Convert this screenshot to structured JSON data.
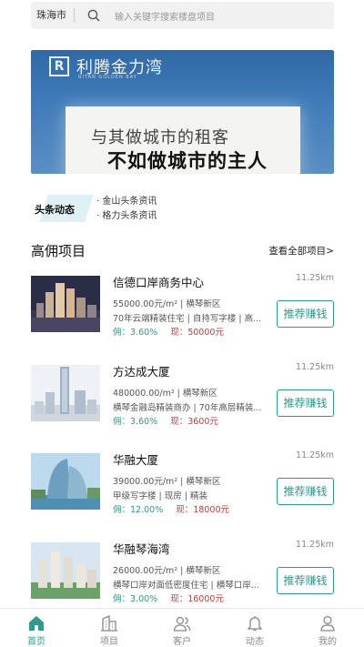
{
  "search": {
    "city": "珠海市",
    "placeholder": "输入关键字搜索楼盘项目"
  },
  "banner": {
    "brand": "利腾金力湾",
    "brand_sub": "RITAN GOLDEN BAY",
    "line1": "与其做城市的租客",
    "line2": "不如做城市的主人"
  },
  "news": {
    "tag": "头条动态",
    "items": [
      "· 金山头条资讯",
      "· 格力头条资讯"
    ]
  },
  "section": {
    "title": "高佣项目",
    "more": "查看全部项目>"
  },
  "projects": [
    {
      "name": "信德口岸商务中心",
      "distance": "11.25km",
      "price": "55000.00元/m² | 横琴新区",
      "tags": "70年云端精装住宅 | 自持写字楼 | 高...",
      "commission_label": "佣：",
      "commission": "3.60%",
      "cash_label": "现：",
      "cash": "50000元",
      "button": "推荐赚钱"
    },
    {
      "name": "方达成大厦",
      "distance": "11.25km",
      "price": "480000.00/m² | 横琴新区",
      "tags": "横琴金融岛精装商办 | 70年高层精装...",
      "commission_label": "佣：",
      "commission": "3.60%",
      "cash_label": "现：",
      "cash": "3600元",
      "button": "推荐赚钱"
    },
    {
      "name": "华融大厦",
      "distance": "11.25km",
      "price": "39000.00元/m² | 横琴新区",
      "tags": "甲级写字楼 | 现房 | 精装",
      "commission_label": "佣：",
      "commission": "12.00%",
      "cash_label": "现：",
      "cash": "18000元",
      "button": "推荐赚钱"
    },
    {
      "name": "华融琴海湾",
      "distance": "11.25km",
      "price": "26000.00元/m² | 横琴新区",
      "tags": "横琴口岸对面低密度住宅 | 横琴口岸...",
      "commission_label": "佣：",
      "commission": "3.00%",
      "cash_label": "现：",
      "cash": "16000元",
      "button": "推荐赚钱"
    }
  ],
  "tabbar": {
    "items": [
      {
        "label": "首页",
        "icon": "home-icon",
        "active": true
      },
      {
        "label": "项目",
        "icon": "building-icon",
        "active": false
      },
      {
        "label": "客户",
        "icon": "people-icon",
        "active": false
      },
      {
        "label": "动态",
        "icon": "bell-icon",
        "active": false
      },
      {
        "label": "我的",
        "icon": "user-icon",
        "active": false
      }
    ]
  },
  "colors": {
    "accent": "#2f9a8e",
    "cash": "#d33333",
    "banner_blue": "#3f7ab8",
    "news_tag_bg": "#dff1f4"
  }
}
